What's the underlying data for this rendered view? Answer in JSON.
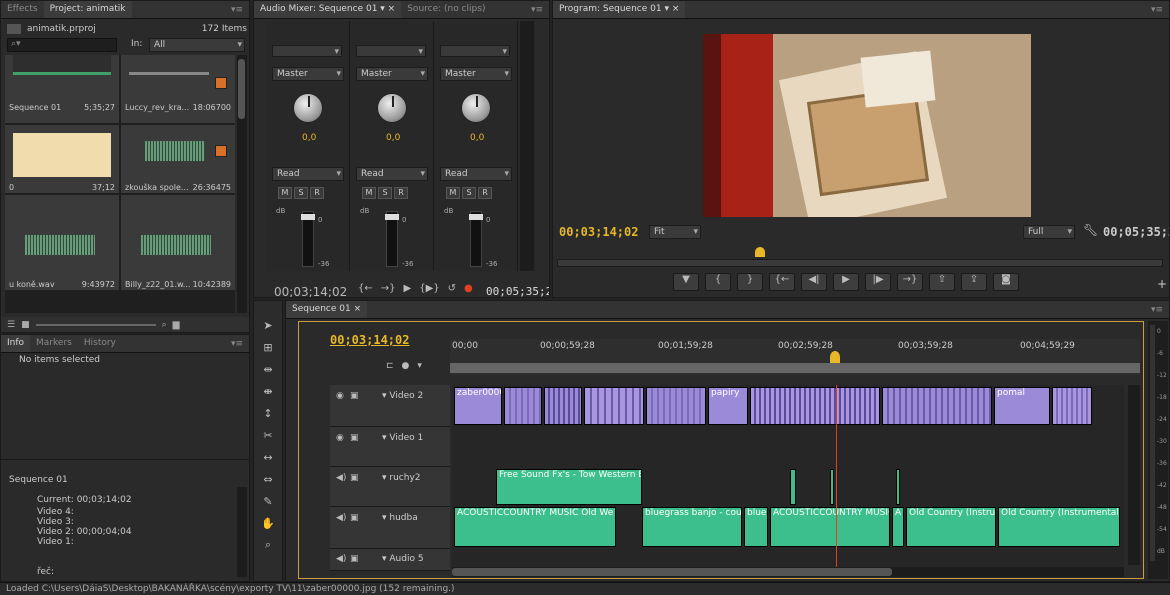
{
  "project": {
    "tabs": [
      "Effects",
      "Project: animatik"
    ],
    "filename": "animatik.prproj",
    "item_count": "172 Items",
    "in_label": "In:",
    "in_value": "All",
    "items": [
      {
        "name": "Sequence 01",
        "duration": "5;35;27"
      },
      {
        "name": "Luccy_rev_kra...",
        "duration": "18:06700"
      },
      {
        "name": "0",
        "duration": "37;12"
      },
      {
        "name": "zkouška spole...",
        "duration": "26:36475"
      },
      {
        "name": "u koně.wav",
        "duration": "9:43972"
      },
      {
        "name": "Billy_z22_01.w...",
        "duration": "10:42389"
      }
    ]
  },
  "info": {
    "tabs": [
      "Info",
      "Markers",
      "History"
    ],
    "no_items": "No items selected",
    "sequence": "Sequence 01",
    "current": "Current: 00;03;14;02",
    "lines": [
      "Video 4:",
      "Video 3:",
      "Video 2: 00;00;04;04",
      "Video 1:"
    ],
    "bottom": "řeč:"
  },
  "mixer": {
    "tabs": [
      "Audio Mixer: Sequence 01",
      "Source: (no clips)"
    ],
    "channels": [
      {
        "out": "Master",
        "value": "0,0",
        "mode": "Read"
      },
      {
        "out": "Master",
        "value": "0,0",
        "mode": "Read"
      },
      {
        "out": "Master",
        "value": "0,0",
        "mode": "Read"
      }
    ],
    "msr": [
      "M",
      "S",
      "R"
    ],
    "db_label": "dB",
    "scale": [
      "6",
      "3",
      "0",
      "-3",
      "-9",
      "-15"
    ],
    "peak": "-36",
    "zero": "0",
    "timecode": "00;03;14;02",
    "duration": "00;05;35;2"
  },
  "program": {
    "tab": "Program: Sequence 01",
    "timecode": "00;03;14;02",
    "fit": "Fit",
    "quality": "Full",
    "duration": "00;05;35;27"
  },
  "timeline": {
    "tab": "Sequence 01",
    "timecode": "00;03;14;02",
    "ruler": [
      "00;00",
      "00;00;59;28",
      "00;01;59;28",
      "00;02;59;28",
      "00;03;59;28",
      "00;04;59;29"
    ],
    "tracks": [
      {
        "name": "Video 2",
        "type": "video"
      },
      {
        "name": "Video 1",
        "type": "video"
      },
      {
        "name": "ruchy2",
        "type": "audio"
      },
      {
        "name": "hudba",
        "type": "audio"
      },
      {
        "name": "Audio 5",
        "type": "audio"
      }
    ],
    "video2_clips": [
      "zaber00000.jpg",
      "7",
      "n",
      "zi",
      "n",
      "20",
      "z",
      "zb",
      "30",
      "32",
      "papiry",
      "za",
      "s",
      "4",
      "50",
      "5",
      "pomal",
      "za",
      "7"
    ],
    "ruchy_clip": "Free Sound Fx's - Tow Western E",
    "hudba_clips": [
      "ACOUSTICCOUNTRY MUSIC Old We",
      "bluegrass banjo - cou",
      "blue",
      "ACOUSTICCOUNTRY MUSIC",
      "A",
      "Old Country (Instrur",
      "Old Country (Instrumental)"
    ],
    "meter_scale": [
      "0",
      "-6",
      "-12",
      "-18",
      "-24",
      "-30",
      "-36",
      "-42",
      "-48",
      "-54",
      "dB"
    ]
  },
  "status": "Loaded C:\\Users\\DáiaS\\Desktop\\BAKANÁŘKA\\scény\\exporty TV\\11\\zaber00000.jpg (152 remaining.)",
  "colors": {
    "timecode": "#e8b828",
    "video_clip": "#9a8ad8",
    "audio_clip": "#3cbf8c",
    "playhead": "#e04020"
  }
}
